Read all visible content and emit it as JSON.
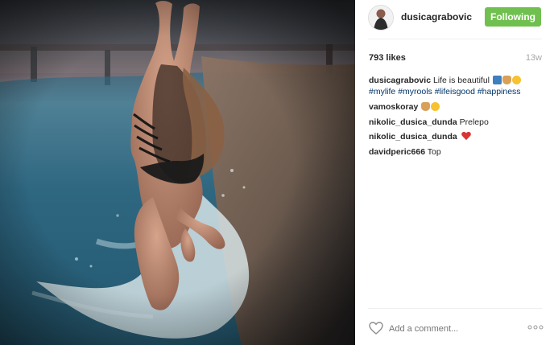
{
  "post": {
    "username": "dusicagrabovic",
    "follow_label": "Following",
    "likes": "793 likes",
    "time": "13w",
    "caption_text": "Life is beautiful",
    "hashtags": [
      "#mylife",
      "#myrools",
      "#lifeisgood",
      "#happiness"
    ]
  },
  "comments": [
    {
      "user": "vamoskoray",
      "text": ""
    },
    {
      "user": "nikolic_dusica_dunda",
      "text": "Prelepo"
    },
    {
      "user": "nikolic_dusica_dunda",
      "text": ""
    },
    {
      "user": "davidperic666",
      "text": "Top"
    }
  ],
  "footer": {
    "add_comment_placeholder": "Add a comment..."
  },
  "icons": {
    "like": "heart-outline-icon",
    "more": "ellipsis-icon",
    "follow_status": "following-icon"
  },
  "colors": {
    "follow_button": "#70c050",
    "hashtag": "#003569",
    "heart": "#d93535"
  }
}
